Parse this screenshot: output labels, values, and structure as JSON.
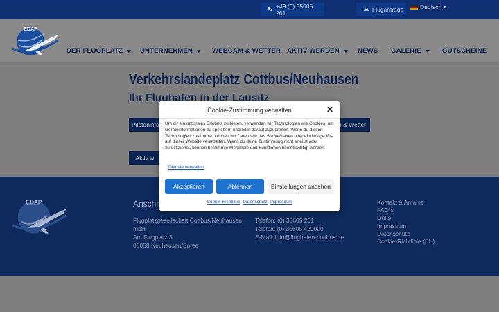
{
  "topbar": {
    "phone": "+49 (0) 35605 261",
    "flight": "Fluganfrage",
    "language": "Deutsch"
  },
  "logo": {
    "text": "EDAP"
  },
  "nav": [
    {
      "label": "DER FLUGPLATZ",
      "dropdown": true
    },
    {
      "label": "UNTERNEHMEN",
      "dropdown": true
    },
    {
      "label": "WEBCAM & WETTER",
      "dropdown": false
    },
    {
      "label": "AKTIV WERDEN",
      "dropdown": true
    },
    {
      "label": "NEWS",
      "dropdown": false
    },
    {
      "label": "GALERIE",
      "dropdown": true
    },
    {
      "label": "GUTSCHEINE",
      "dropdown": false
    }
  ],
  "main": {
    "title": "Verkehrslandeplatz Cottbus/Neuhausen",
    "subtitle": "Ihr Flughafen in der Lausitz",
    "btn_pilot": "Piloteninfo",
    "btn_webcam": "n & Wetter",
    "btn_aktiv": "Aktiv w"
  },
  "footer": {
    "heading": "Anschrift",
    "address": [
      "Flugplatzgesellschaft Cottbus/Neuhausen",
      "mbH",
      "Am Flugplatz 3",
      "03058 Neuhausen/Spree"
    ],
    "contact": [
      "Telefon: (0) 35605 261",
      "Telefax: (0) 35605 429029",
      "E-Mail: info@flughafen-cottbus.de"
    ],
    "links": [
      "Kontakt & Anfahrt",
      "FAQ´s",
      "Links",
      "Impressum",
      "Datenschutz",
      "Cookie-Richtlinie (EU)"
    ]
  },
  "modal": {
    "title": "Cookie-Zustimmung verwalten",
    "text": "Um dir ein optimales Erlebnis zu bieten, verwenden wir Technologien wie Cookies, um Geräteinformationen zu speichern und/oder darauf zuzugreifen. Wenn du diesen Technologien zustimmst, können wir Daten wie das Surfverhalten oder eindeutige IDs auf dieser Website verarbeiten. Wenn du deine Zustimmung nicht erteilst oder zurückziehst, können bestimmte Merkmale und Funktionen beeinträchtigt werden.",
    "services_link": "Dienste verwalten",
    "accept": "Akzeptieren",
    "deny": "Ablehnen",
    "settings": "Einstellungen ansehen",
    "links": [
      "Cookie-Richtlinie",
      "Datenschutz",
      "Impressum"
    ]
  },
  "colors": {
    "navy": "#0b2350",
    "footer": "#0e2a5c",
    "accent_blue": "#1e73d0",
    "overlay_gray": "#7f7f7f"
  }
}
